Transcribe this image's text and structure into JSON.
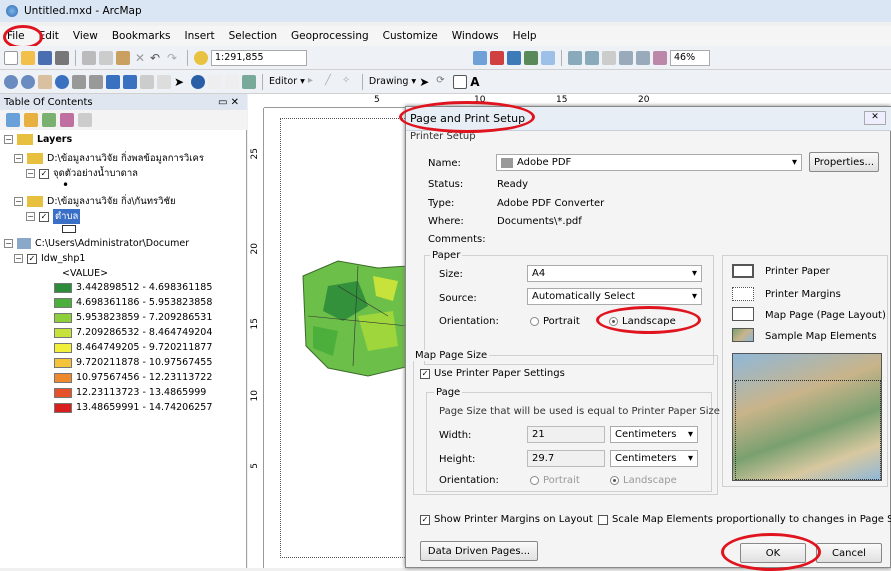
{
  "window": {
    "title": "Untitled.mxd - ArcMap"
  },
  "menu": [
    "File",
    "Edit",
    "View",
    "Bookmarks",
    "Insert",
    "Selection",
    "Geoprocessing",
    "Customize",
    "Windows",
    "Help"
  ],
  "toolbar": {
    "scale": "1:291,855",
    "zoom": "46%",
    "editor": "Editor ▾",
    "drawing": "Drawing ▾"
  },
  "toc": {
    "title": "Table Of Contents",
    "pin": "▭ ✕",
    "items": [
      "Layers",
      "D:\\ข้อมูลงานวิจัย กิ่งพลข้อมูลการวิเคร",
      "จุดตัวอย่างน้ำบาดาล",
      "•",
      "D:\\ข้อมูลงานวิจัย กิ่ง\\กันทรวิชัย",
      "ตำบล",
      "C:\\Users\\Administrator\\Documer",
      "Idw_shp1",
      "<VALUE>"
    ],
    "legend": [
      {
        "label": "3.442898512 - 4.698361185",
        "color": "#2e8b3a"
      },
      {
        "label": "4.698361186 - 5.953823858",
        "color": "#4caf3c"
      },
      {
        "label": "5.953823859 - 7.209286531",
        "color": "#8ccf3a"
      },
      {
        "label": "7.209286532 - 8.464749204",
        "color": "#c7e23a"
      },
      {
        "label": "8.464749205 - 9.720211877",
        "color": "#f2ef3a"
      },
      {
        "label": "9.720211878 - 10.97567455",
        "color": "#f5c33a"
      },
      {
        "label": "10.97567456 - 12.23113722",
        "color": "#ef8a2c"
      },
      {
        "label": "12.23113723 - 13.4865999",
        "color": "#e6502a"
      },
      {
        "label": "13.48659991 - 14.74206257",
        "color": "#d81e1e"
      }
    ]
  },
  "ruler": {
    "h": [
      "5",
      "10",
      "15",
      "20"
    ],
    "v": [
      "25",
      "20",
      "15",
      "10",
      "5"
    ]
  },
  "dialog": {
    "title": "Page and Print Setup",
    "close": "✕",
    "printer_setup": "Printer Setup",
    "name_label": "Name:",
    "name_value": "Adobe PDF",
    "properties": "Properties...",
    "status_label": "Status:",
    "status_value": "Ready",
    "type_label": "Type:",
    "type_value": "Adobe PDF Converter",
    "where_label": "Where:",
    "where_value": "Documents\\*.pdf",
    "comments_label": "Comments:",
    "paper": "Paper",
    "size_label": "Size:",
    "size_value": "A4",
    "source_label": "Source:",
    "source_value": "Automatically Select",
    "orientation_label": "Orientation:",
    "portrait": "Portrait",
    "landscape": "Landscape",
    "map_page_size": "Map Page Size",
    "use_printer": "Use Printer Paper Settings",
    "page": "Page",
    "page_note": "Page Size that will be used is equal to Printer Paper Size",
    "width_label": "Width:",
    "width_value": "21",
    "height_label": "Height:",
    "height_value": "29.7",
    "units": "Centimeters",
    "orientation2_label": "Orientation:",
    "legend": [
      "Printer Paper",
      "Printer Margins",
      "Map Page (Page Layout)",
      "Sample Map Elements"
    ],
    "show_margins": "Show Printer Margins on Layout",
    "scale_elements": "Scale Map Elements proportionally to changes in Page Size",
    "ddp": "Data Driven Pages...",
    "ok": "OK",
    "cancel": "Cancel"
  }
}
